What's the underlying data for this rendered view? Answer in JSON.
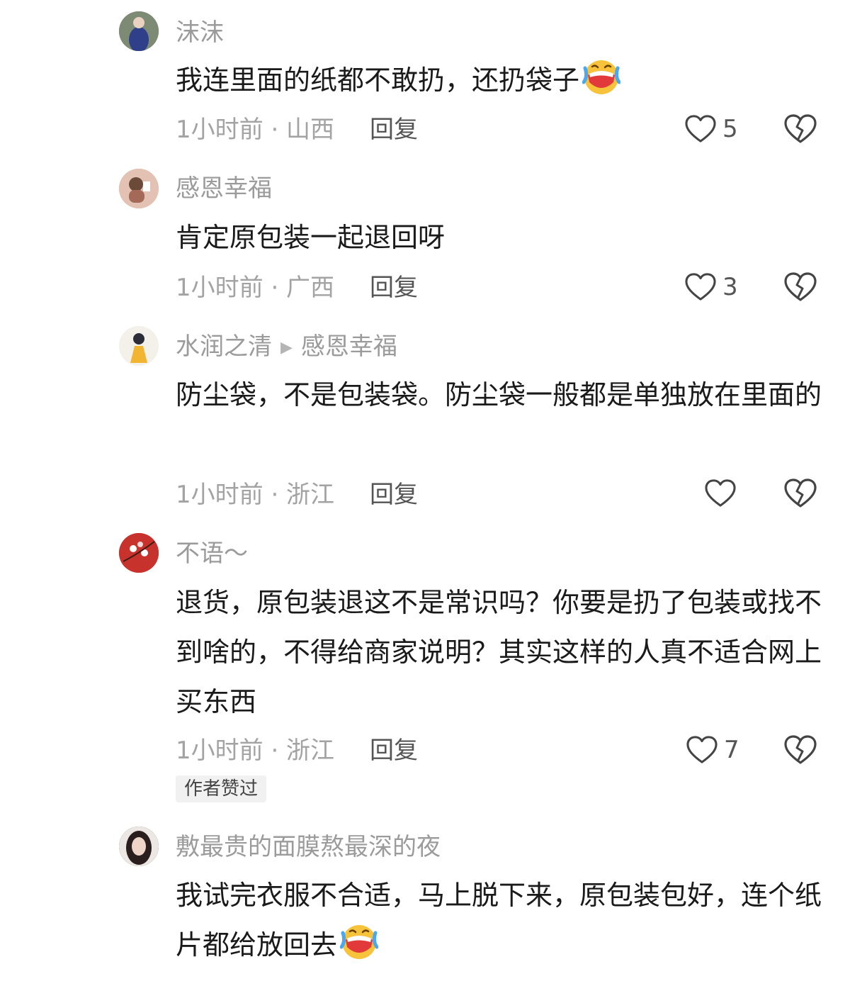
{
  "comments": [
    {
      "username": "沫沫",
      "text": "我连里面的纸都不敢扔，还扔袋子",
      "emoji": "laughing-emoji",
      "time_location": "1小时前 · 山西",
      "reply_label": "回复",
      "likes": "5"
    },
    {
      "username": "感恩幸福",
      "text": "肯定原包装一起退回呀",
      "time_location": "1小时前 · 广西",
      "reply_label": "回复",
      "likes": "3"
    },
    {
      "username": "水润之清",
      "reply_to": "感恩幸福",
      "text": "防尘袋，不是包装袋。防尘袋一般都是单独放在里面的",
      "time_location": "1小时前 · 浙江",
      "reply_label": "回复",
      "likes": ""
    },
    {
      "username": "不语～",
      "text": "退货，原包装退这不是常识吗？你要是扔了包装或找不到啥的，不得给商家说明？其实这样的人真不适合网上买东西",
      "time_location": "1小时前 · 浙江",
      "reply_label": "回复",
      "likes": "7",
      "badge": "作者赞过"
    },
    {
      "username": "敷最贵的面膜熬最深的夜",
      "text": "我试完衣服不合适，马上脱下来，原包装包好，连个纸片都给放回去",
      "emoji": "laughing-emoji"
    }
  ],
  "colors": {
    "text": "#1a1a1a",
    "secondary": "#9b9b9b",
    "icon_stroke": "#444444",
    "badge_bg": "#f1f1f1"
  }
}
